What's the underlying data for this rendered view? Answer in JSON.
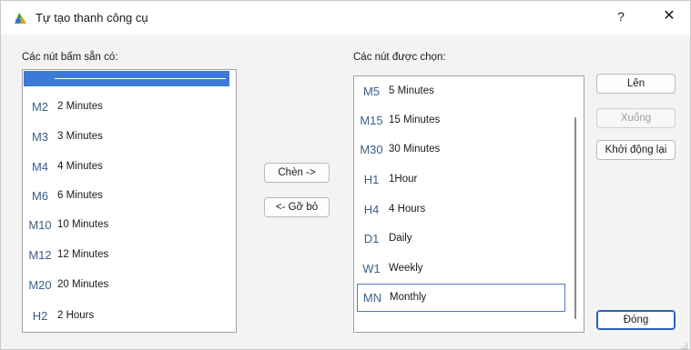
{
  "window": {
    "title": "Tự tạo thanh công cụ",
    "help_label": "?",
    "close_label": "✕"
  },
  "available": {
    "label": "Các nút bấm sẵn có:",
    "items": [
      {
        "code": "M2",
        "name": "2 Minutes"
      },
      {
        "code": "M3",
        "name": "3 Minutes"
      },
      {
        "code": "M4",
        "name": "4 Minutes"
      },
      {
        "code": "M6",
        "name": "6 Minutes"
      },
      {
        "code": "M10",
        "name": "10 Minutes"
      },
      {
        "code": "M12",
        "name": "12 Minutes"
      },
      {
        "code": "M20",
        "name": "20 Minutes"
      },
      {
        "code": "H2",
        "name": "2 Hours"
      }
    ]
  },
  "chosen": {
    "label": "Các nút được chọn:",
    "items": [
      {
        "code": "M5",
        "name": "5 Minutes"
      },
      {
        "code": "M15",
        "name": "15 Minutes"
      },
      {
        "code": "M30",
        "name": "30 Minutes"
      },
      {
        "code": "H1",
        "name": "1Hour"
      },
      {
        "code": "H4",
        "name": "4 Hours"
      },
      {
        "code": "D1",
        "name": "Daily"
      },
      {
        "code": "W1",
        "name": "Weekly"
      },
      {
        "code": "MN",
        "name": "Monthly"
      }
    ]
  },
  "buttons": {
    "insert": "Chèn ->",
    "remove": "<- Gỡ bỏ",
    "up": "Lên",
    "down": "Xuống",
    "reset": "Khởi động lại",
    "close": "Đóng"
  },
  "colors": {
    "selection": "#3d7ad8",
    "code_text": "#3a5f8a",
    "focus_border": "#4a7ac0"
  }
}
